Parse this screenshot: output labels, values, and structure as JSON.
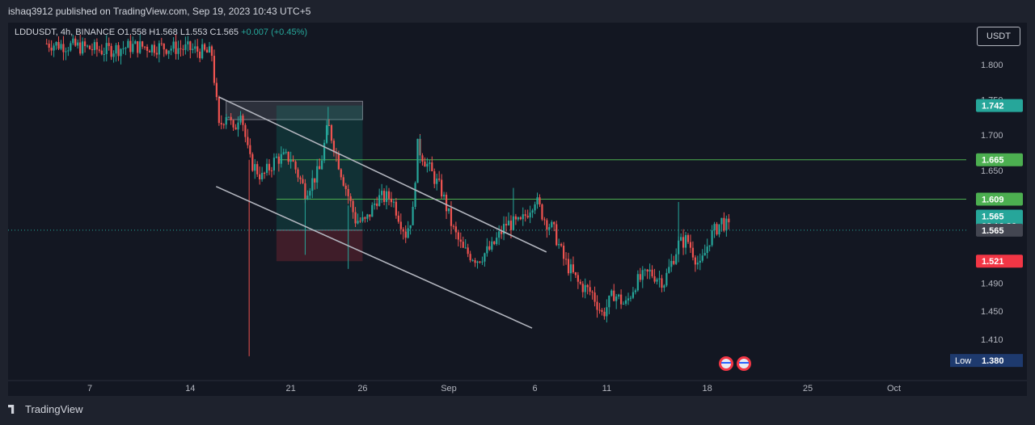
{
  "header": {
    "publisher": "ishaq3912 published on TradingView.com, Sep 19, 2023 10:43 UTC+5"
  },
  "legend": {
    "symbol": "LDDUSDT, 4h, BINANCE",
    "ohlc": "O1.558 H1.568 L1.553 C1.565",
    "change": "+0.007 (+0.45%)"
  },
  "currency_button": "USDT",
  "footer": {
    "brand": "TradingView"
  },
  "colors": {
    "up": "#26a69a",
    "down": "#ef5350",
    "bg": "#131722",
    "target": "#4caf50",
    "stop": "#f23645"
  },
  "chart_data": {
    "type": "candlestick",
    "ylim": [
      1.38,
      1.84
    ],
    "y_ticks": [
      "1.800",
      "1.750",
      "1.700",
      "1.650",
      "1.520",
      "1.490",
      "1.450",
      "1.410"
    ],
    "x_ticks": [
      "7",
      "14",
      "21",
      "26",
      "Sep",
      "6",
      "11",
      "18",
      "25",
      "Oct"
    ],
    "price_labels": [
      {
        "text": "1.742",
        "value": 1.742,
        "color": "#26a69a"
      },
      {
        "text": "1.665",
        "value": 1.665,
        "color": "#4caf50"
      },
      {
        "text": "1.609",
        "value": 1.609,
        "color": "#4caf50"
      },
      {
        "text": "1.565",
        "value": 1.578,
        "color": "#26a69a",
        "countdown": "02:16:36"
      },
      {
        "text": "1.565",
        "value": 1.565,
        "color": "#434651"
      },
      {
        "text": "1.521",
        "value": 1.521,
        "color": "#f23645"
      }
    ],
    "low_label": {
      "title": "Low",
      "value": "1.380"
    },
    "channel": {
      "upper": [
        [
          16.0,
          1.754
        ],
        [
          38.8,
          1.534
        ]
      ],
      "lower": [
        [
          15.8,
          1.627
        ],
        [
          37.8,
          1.426
        ]
      ]
    },
    "resistance_zone": {
      "x0": 16.5,
      "x1": 26.0,
      "top": 1.748,
      "bottom": 1.722
    },
    "position": {
      "x0": 20.0,
      "x1": 26.0,
      "entry": 1.565,
      "target": 1.742,
      "stop": 1.521,
      "tp1": 1.665,
      "tp2": 1.609
    },
    "x_tick_positions": [
      7,
      14,
      21,
      26,
      32,
      38,
      43,
      50,
      57,
      63
    ],
    "candles_time_start": 4.0,
    "candles_per_unit": 6,
    "path_points": [
      [
        4.0,
        1.83
      ],
      [
        6.0,
        1.826
      ],
      [
        8.0,
        1.82
      ],
      [
        10.0,
        1.826
      ],
      [
        12.0,
        1.825
      ],
      [
        14.0,
        1.822
      ],
      [
        15.5,
        1.815
      ],
      [
        16.0,
        1.71
      ],
      [
        16.6,
        1.735
      ],
      [
        17.0,
        1.702
      ],
      [
        17.5,
        1.738
      ],
      [
        18.1,
        1.665
      ],
      [
        19.0,
        1.64
      ],
      [
        20.0,
        1.667
      ],
      [
        21.0,
        1.668
      ],
      [
        22.0,
        1.62
      ],
      [
        23.0,
        1.65
      ],
      [
        23.6,
        1.715
      ],
      [
        24.5,
        1.648
      ],
      [
        25.5,
        1.58
      ],
      [
        26.2,
        1.576
      ],
      [
        27.0,
        1.61
      ],
      [
        28.0,
        1.612
      ],
      [
        29.0,
        1.56
      ],
      [
        29.5,
        1.59
      ],
      [
        29.8,
        1.685
      ],
      [
        30.7,
        1.65
      ],
      [
        31.5,
        1.62
      ],
      [
        32.3,
        1.566
      ],
      [
        33.0,
        1.536
      ],
      [
        34.0,
        1.524
      ],
      [
        35.0,
        1.54
      ],
      [
        36.0,
        1.574
      ],
      [
        37.0,
        1.574
      ],
      [
        38.0,
        1.61
      ],
      [
        38.7,
        1.58
      ],
      [
        39.3,
        1.565
      ],
      [
        40.0,
        1.524
      ],
      [
        41.0,
        1.49
      ],
      [
        42.0,
        1.475
      ],
      [
        42.7,
        1.445
      ],
      [
        43.5,
        1.475
      ],
      [
        44.3,
        1.458
      ],
      [
        45.0,
        1.49
      ],
      [
        46.0,
        1.505
      ],
      [
        47.0,
        1.492
      ],
      [
        48.0,
        1.545
      ],
      [
        48.6,
        1.552
      ],
      [
        49.5,
        1.512
      ],
      [
        50.2,
        1.555
      ],
      [
        51.0,
        1.578
      ],
      [
        51.6,
        1.565
      ]
    ],
    "spikes": [
      {
        "t": 18.1,
        "hi": 1.665,
        "lo": 1.386
      },
      {
        "t": 23.6,
        "hi": 1.74,
        "lo": 1.7
      },
      {
        "t": 30.0,
        "hi": 1.7,
        "lo": 1.66
      },
      {
        "t": 25.0,
        "hi": 1.6,
        "lo": 1.51
      },
      {
        "t": 22.0,
        "hi": 1.61,
        "lo": 1.53
      },
      {
        "t": 48.0,
        "hi": 1.605,
        "lo": 1.54
      },
      {
        "t": 36.5,
        "hi": 1.625,
        "lo": 1.58
      }
    ]
  }
}
